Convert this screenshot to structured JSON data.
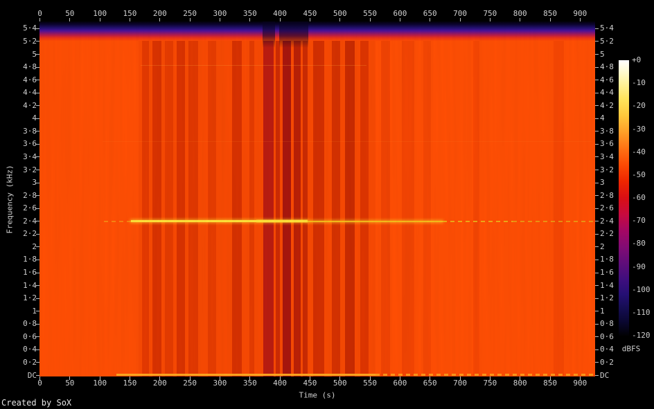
{
  "watermark": "Created by SoX",
  "axes": {
    "time": {
      "label": "Time (s)",
      "ticks": [
        0,
        50,
        100,
        150,
        200,
        250,
        300,
        350,
        400,
        450,
        500,
        550,
        600,
        650,
        700,
        750,
        800,
        850,
        900
      ]
    },
    "freq": {
      "label": "Frequency (kHz)",
      "ticks": [
        {
          "v": 5.4,
          "t": "5·4"
        },
        {
          "v": 5.2,
          "t": "5·2"
        },
        {
          "v": 5,
          "t": "5"
        },
        {
          "v": 4.8,
          "t": "4·8"
        },
        {
          "v": 4.6,
          "t": "4·6"
        },
        {
          "v": 4.4,
          "t": "4·4"
        },
        {
          "v": 4.2,
          "t": "4·2"
        },
        {
          "v": 4,
          "t": "4"
        },
        {
          "v": 3.8,
          "t": "3·8"
        },
        {
          "v": 3.6,
          "t": "3·6"
        },
        {
          "v": 3.4,
          "t": "3·4"
        },
        {
          "v": 3.2,
          "t": "3·2"
        },
        {
          "v": 3,
          "t": "3"
        },
        {
          "v": 2.8,
          "t": "2·8"
        },
        {
          "v": 2.6,
          "t": "2·6"
        },
        {
          "v": 2.4,
          "t": "2·4"
        },
        {
          "v": 2.2,
          "t": "2·2"
        },
        {
          "v": 2,
          "t": "2"
        },
        {
          "v": 1.8,
          "t": "1·8"
        },
        {
          "v": 1.6,
          "t": "1·6"
        },
        {
          "v": 1.4,
          "t": "1·4"
        },
        {
          "v": 1.2,
          "t": "1·2"
        },
        {
          "v": 1,
          "t": "1"
        },
        {
          "v": 0.8,
          "t": "0·8"
        },
        {
          "v": 0.6,
          "t": "0·6"
        },
        {
          "v": 0.4,
          "t": "0·4"
        },
        {
          "v": 0.2,
          "t": "0·2"
        },
        {
          "v": 0,
          "t": "DC"
        }
      ]
    },
    "level": {
      "label": "dBFS",
      "ticks": [
        {
          "v": 0,
          "t": "+0"
        },
        {
          "v": -10,
          "t": "-10"
        },
        {
          "v": -20,
          "t": "-20"
        },
        {
          "v": -30,
          "t": "-30"
        },
        {
          "v": -40,
          "t": "-40"
        },
        {
          "v": -50,
          "t": "-50"
        },
        {
          "v": -60,
          "t": "-60"
        },
        {
          "v": -70,
          "t": "-70"
        },
        {
          "v": -80,
          "t": "-80"
        },
        {
          "v": -90,
          "t": "-90"
        },
        {
          "v": -100,
          "t": "-100"
        },
        {
          "v": -110,
          "t": "-110"
        },
        {
          "v": -120,
          "t": "-120"
        }
      ]
    }
  },
  "chart_data": {
    "type": "heatmap",
    "subtype": "audio-spectrogram",
    "title": "",
    "xlabel": "Time (s)",
    "ylabel": "Frequency (kHz)",
    "x_range_s": [
      0,
      925
    ],
    "y_range_khz": [
      0,
      5.51
    ],
    "color_scale": {
      "label": "dBFS",
      "range": [
        -120,
        0
      ],
      "legend_position": "right",
      "stops": [
        [
          0,
          "#ffffff"
        ],
        [
          -20,
          "#ffd94c"
        ],
        [
          -40,
          "#ff6a10"
        ],
        [
          -60,
          "#cf0a30"
        ],
        [
          -80,
          "#8a0876"
        ],
        [
          -100,
          "#2a0f78"
        ],
        [
          -120,
          "#000000"
        ]
      ]
    },
    "summary": "Broadband energy around -35 to -45 dBFS fills 0 to ~5.2 kHz for the whole 0-925 s duration; energy rolls off sharply above ~5.2 kHz (dark band at top). A bright narrowband tone sits at ~2.4 kHz from ~110 s to the end, and a bright low-frequency/DC line runs from ~130 s to the end. Quieter (darker red) vertical bands occur mainly between ~165 s and ~560 s, strongest near 370-450 s.",
    "top_rolloff_band": {
      "f_start_khz": 5.2,
      "f_end_khz": 5.51,
      "dark_columns": [
        {
          "t0": 372,
          "t1": 392
        },
        {
          "t0": 399,
          "t1": 448
        }
      ]
    },
    "vertical_bands": [
      {
        "t0": 165,
        "t1": 560,
        "color": "#cc2e00",
        "opacity": 0.14
      },
      {
        "t0": 171,
        "t1": 182,
        "color": "#c82400",
        "opacity": 0.4
      },
      {
        "t0": 188,
        "t1": 203,
        "color": "#bc1c00",
        "opacity": 0.5
      },
      {
        "t0": 209,
        "t1": 223,
        "color": "#c82400",
        "opacity": 0.38
      },
      {
        "t0": 228,
        "t1": 242,
        "color": "#bc1c00",
        "opacity": 0.5
      },
      {
        "t0": 248,
        "t1": 264,
        "color": "#c32100",
        "opacity": 0.42
      },
      {
        "t0": 280,
        "t1": 294,
        "color": "#c82400",
        "opacity": 0.35
      },
      {
        "t0": 321,
        "t1": 337,
        "color": "#b81a00",
        "opacity": 0.5
      },
      {
        "t0": 350,
        "t1": 358,
        "color": "#c32100",
        "opacity": 0.35
      },
      {
        "t0": 373,
        "t1": 390,
        "color": "#9c0818",
        "opacity": 0.68
      },
      {
        "t0": 394,
        "t1": 401,
        "color": "#aa1205",
        "opacity": 0.55
      },
      {
        "t0": 405,
        "t1": 419,
        "color": "#8e0512",
        "opacity": 0.75
      },
      {
        "t0": 423,
        "t1": 435,
        "color": "#990a08",
        "opacity": 0.65
      },
      {
        "t0": 438,
        "t1": 447,
        "color": "#a51103",
        "opacity": 0.55
      },
      {
        "t0": 456,
        "t1": 474,
        "color": "#b01600",
        "opacity": 0.5
      },
      {
        "t0": 487,
        "t1": 501,
        "color": "#b01600",
        "opacity": 0.48
      },
      {
        "t0": 509,
        "t1": 525,
        "color": "#a21000",
        "opacity": 0.55
      },
      {
        "t0": 534,
        "t1": 548,
        "color": "#b81a00",
        "opacity": 0.4
      },
      {
        "t0": 569,
        "t1": 584,
        "color": "#c82400",
        "opacity": 0.25
      },
      {
        "t0": 604,
        "t1": 624,
        "color": "#c82400",
        "opacity": 0.22
      },
      {
        "t0": 639,
        "t1": 652,
        "color": "#cc2800",
        "opacity": 0.2
      },
      {
        "t0": 722,
        "t1": 733,
        "color": "#cc2800",
        "opacity": 0.18
      },
      {
        "t0": 856,
        "t1": 874,
        "color": "#cc2800",
        "opacity": 0.18
      }
    ],
    "horizontal_lines": [
      {
        "f_khz": 4.83,
        "segments": [
          {
            "t0": 168,
            "t1": 545,
            "style": "solid",
            "color": "#ff9632",
            "h": 1.5,
            "opacity": 0.3
          }
        ]
      },
      {
        "f_khz": 3.64,
        "segments": [
          {
            "t0": 105,
            "t1": 920,
            "style": "solid",
            "color": "#ff8428",
            "h": 1.5,
            "opacity": 0.16
          }
        ]
      },
      {
        "f_khz": 2.4,
        "segments": [
          {
            "t0": 107,
            "t1": 152,
            "style": "dashed",
            "color": "#f0b81e",
            "h": 2,
            "opacity": 0.5
          },
          {
            "t0": 361,
            "t1": 447,
            "style": "solid",
            "color": "#ffd020",
            "h": 5,
            "opacity": 0.45
          },
          {
            "t0": 152,
            "t1": 447,
            "style": "solid",
            "color": "#ffe23a",
            "h": 3,
            "opacity": 1,
            "glow": true
          },
          {
            "t0": 447,
            "t1": 672,
            "style": "solid",
            "color": "#f6c61e",
            "h": 2,
            "opacity": 0.92,
            "glow": true
          },
          {
            "t0": 672,
            "t1": 788,
            "style": "dashed",
            "color": "#edb81a",
            "h": 2,
            "opacity": 0.85
          },
          {
            "t0": 788,
            "t1": 924,
            "style": "dashed",
            "color": "#e8b018",
            "h": 2,
            "opacity": 0.7
          }
        ]
      },
      {
        "f_khz": 0.01,
        "segments": [
          {
            "t0": 128,
            "t1": 560,
            "style": "solid",
            "color": "#ffac20",
            "h": 2.5,
            "opacity": 0.95
          },
          {
            "t0": 560,
            "t1": 924,
            "style": "dashed",
            "color": "#ffa51c",
            "h": 2.5,
            "opacity": 0.85
          }
        ]
      }
    ]
  }
}
